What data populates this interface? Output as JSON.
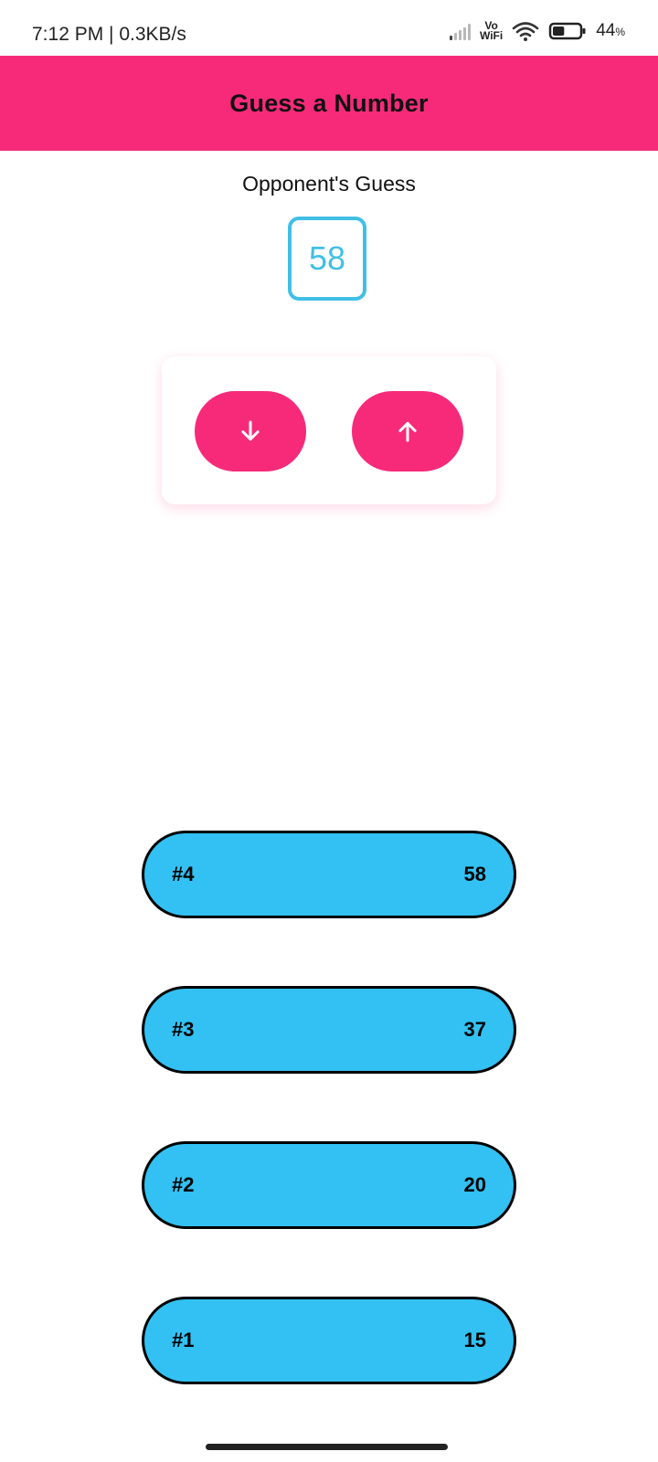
{
  "status_bar": {
    "time_speed": "7:12 PM | 0.3KB/s",
    "vowifi_top": "Vo",
    "vowifi_bottom": "WiFi",
    "battery_percent": "44",
    "battery_unit": "%",
    "battery_level": 0.44
  },
  "header": {
    "title": "Guess a Number"
  },
  "opponent": {
    "label": "Opponent's Guess",
    "current_guess": "58"
  },
  "controls": {
    "lower_icon": "arrow-down-icon",
    "higher_icon": "arrow-up-icon"
  },
  "guess_log": [
    {
      "round": "#4",
      "value": "58"
    },
    {
      "round": "#3",
      "value": "37"
    },
    {
      "round": "#2",
      "value": "20"
    },
    {
      "round": "#1",
      "value": "15"
    }
  ],
  "colors": {
    "header": "#f72a7a",
    "accent_blue": "#41bfe6",
    "log_item": "#32c1f2",
    "button": "#f72a7a"
  }
}
